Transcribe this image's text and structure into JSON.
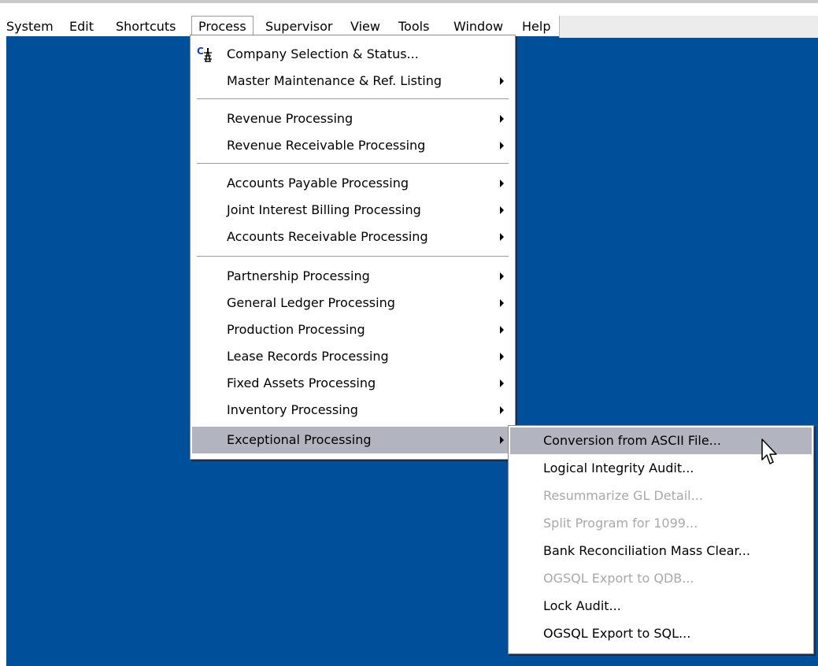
{
  "menubar": {
    "items": [
      {
        "label": "System"
      },
      {
        "label": "Edit"
      },
      {
        "label": "Shortcuts"
      },
      {
        "label": "Process"
      },
      {
        "label": "Supervisor"
      },
      {
        "label": "View"
      },
      {
        "label": "Tools"
      },
      {
        "label": "Window"
      },
      {
        "label": "Help"
      }
    ]
  },
  "process_menu": {
    "items": [
      {
        "label": "Company Selection & Status...",
        "icon": "company-icon",
        "submenu": false
      },
      {
        "label": "Master Maintenance & Ref. Listing",
        "submenu": true
      },
      {
        "label": "Revenue Processing",
        "submenu": true
      },
      {
        "label": "Revenue Receivable Processing",
        "submenu": true
      },
      {
        "label": "Accounts Payable Processing",
        "submenu": true
      },
      {
        "label": "Joint Interest Billing Processing",
        "submenu": true
      },
      {
        "label": "Accounts Receivable Processing",
        "submenu": true
      },
      {
        "label": "Partnership Processing",
        "submenu": true
      },
      {
        "label": "General Ledger Processing",
        "submenu": true
      },
      {
        "label": "Production Processing",
        "submenu": true
      },
      {
        "label": "Lease Records Processing",
        "submenu": true
      },
      {
        "label": "Fixed Assets Processing",
        "submenu": true
      },
      {
        "label": "Inventory Processing",
        "submenu": true
      },
      {
        "label": "Exceptional Processing",
        "submenu": true,
        "highlighted": true
      }
    ]
  },
  "exceptional_submenu": {
    "items": [
      {
        "label": "Conversion from ASCII File...",
        "enabled": true,
        "highlighted": true
      },
      {
        "label": "Logical Integrity Audit...",
        "enabled": true
      },
      {
        "label": "Resummarize GL Detail...",
        "enabled": false
      },
      {
        "label": "Split Program for 1099...",
        "enabled": false
      },
      {
        "label": "Bank Reconciliation Mass Clear...",
        "enabled": true
      },
      {
        "label": "OGSQL Export to QDB...",
        "enabled": false
      },
      {
        "label": "Lock Audit...",
        "enabled": true
      },
      {
        "label": "OGSQL Export to SQL...",
        "enabled": true
      }
    ]
  },
  "colors": {
    "desktop": "#004f9b",
    "highlight": "#b2b4bf",
    "disabled_text": "#a9a9a9"
  }
}
